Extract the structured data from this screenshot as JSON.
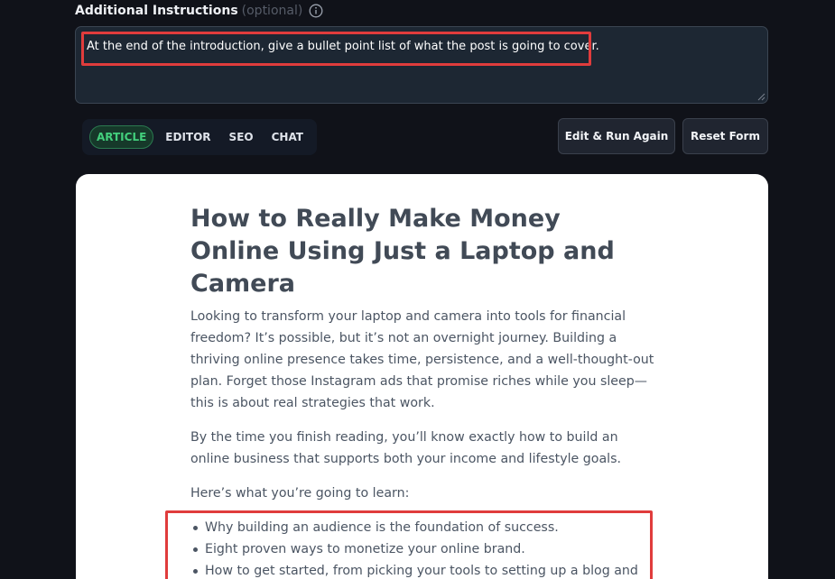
{
  "instructions": {
    "label": "Additional Instructions",
    "optional": "(optional)",
    "info_icon": "info-circle-icon",
    "value": "At the end of the introduction, give a bullet point list of what the post is going to cover."
  },
  "tabs": [
    {
      "label": "ARTICLE",
      "active": true
    },
    {
      "label": "EDITOR",
      "active": false
    },
    {
      "label": "SEO",
      "active": false
    },
    {
      "label": "CHAT",
      "active": false
    }
  ],
  "buttons": {
    "edit_run": "Edit & Run Again",
    "reset": "Reset Form"
  },
  "article": {
    "title": "How to Really Make Money Online Using Just a Laptop and Camera",
    "paragraphs": [
      "Looking to transform your laptop and camera into tools for financial freedom? It’s possible, but it’s not an overnight journey. Building a thriving online presence takes time, persistence, and a well-thought-out plan. Forget those Instagram ads that promise riches while you sleep—this is about real strategies that work.",
      "By the time you finish reading, you’ll know exactly how to build an online business that supports both your income and lifestyle goals.",
      "Here’s what you’re going to learn:"
    ],
    "bullets": [
      "Why building an audience is the foundation of success.",
      "Eight proven ways to monetize your online brand.",
      "How to get started, from picking your tools to setting up a blog and newsletter."
    ]
  },
  "colors": {
    "background": "#101219",
    "highlight": "#e03c3c",
    "tab_active": "#43d07d"
  }
}
